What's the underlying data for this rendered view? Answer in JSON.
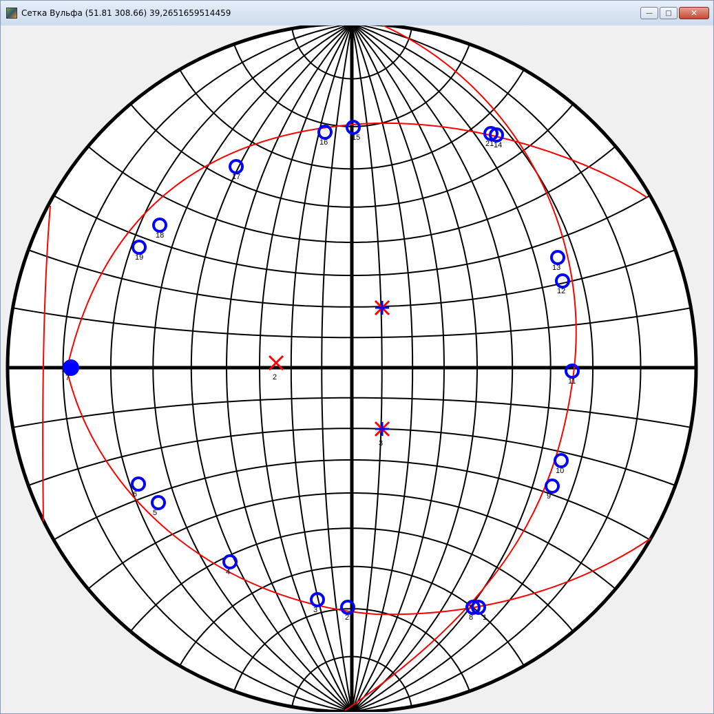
{
  "window": {
    "title": "Сетка Вульфа (51.81 308.66) 39,2651659514459",
    "minimize_label": "—",
    "maximize_label": "□",
    "close_label": "✕"
  },
  "colors": {
    "grid": "#000000",
    "poles": "#0000ff",
    "great_circles": "#ff0000",
    "markers": "#ff0000"
  },
  "points": [
    {
      "id": "p1",
      "label": "1"
    },
    {
      "id": "p2",
      "label": "2"
    },
    {
      "id": "p3",
      "label": "3"
    },
    {
      "id": "p4",
      "label": "4"
    },
    {
      "id": "p5",
      "label": "5"
    },
    {
      "id": "p6",
      "label": "6"
    },
    {
      "id": "p7",
      "label": "7"
    },
    {
      "id": "p8",
      "label": "8"
    },
    {
      "id": "p9",
      "label": "9"
    },
    {
      "id": "p10",
      "label": "10"
    },
    {
      "id": "p11",
      "label": "11"
    },
    {
      "id": "p12",
      "label": "12"
    },
    {
      "id": "p13",
      "label": "13"
    },
    {
      "id": "p14",
      "label": "14"
    },
    {
      "id": "p15",
      "label": "15"
    },
    {
      "id": "p16",
      "label": "16"
    },
    {
      "id": "p17",
      "label": "17"
    },
    {
      "id": "p18",
      "label": "18"
    },
    {
      "id": "p19",
      "label": "19"
    },
    {
      "id": "p20",
      "label": "21"
    }
  ],
  "markers": [
    {
      "id": "m2",
      "label": "2",
      "shape": "x"
    },
    {
      "id": "m3",
      "label": "3",
      "shape": "star"
    },
    {
      "id": "m1",
      "label": "",
      "shape": "star"
    }
  ]
}
